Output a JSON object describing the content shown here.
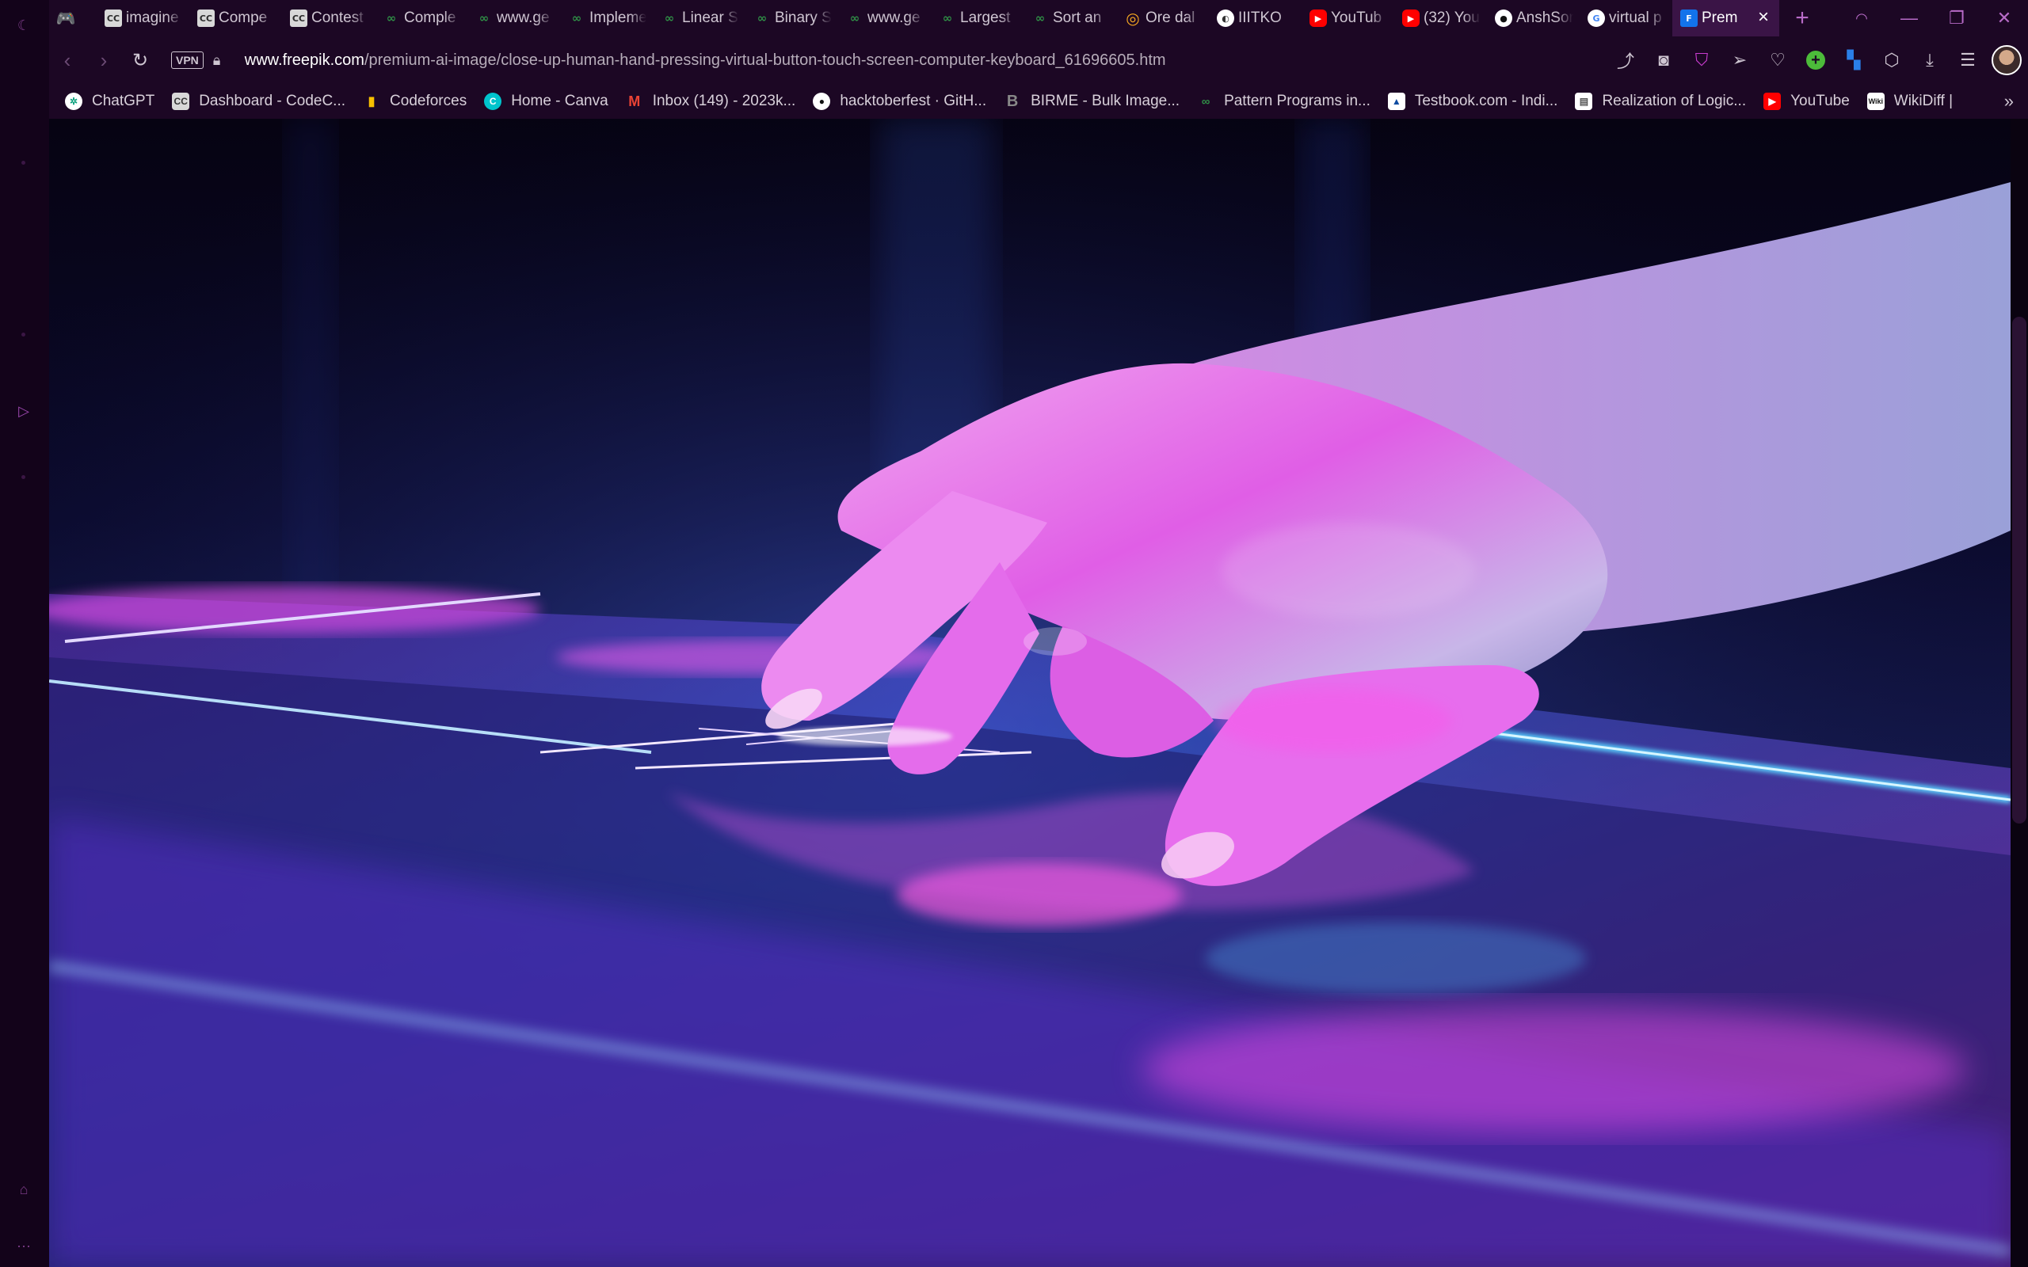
{
  "tabs": [
    {
      "title": "",
      "favicon": "game-icon",
      "fav_class": "fav-game",
      "fav_glyph": "🎮"
    },
    {
      "title": "imagine",
      "favicon": "codechef-icon",
      "fav_class": "fav-cc",
      "fav_glyph": "CC"
    },
    {
      "title": "Compe",
      "favicon": "codechef-icon",
      "fav_class": "fav-cc",
      "fav_glyph": "CC"
    },
    {
      "title": "Contest",
      "favicon": "codechef-icon",
      "fav_class": "fav-cc",
      "fav_glyph": "CC"
    },
    {
      "title": "Comple",
      "favicon": "geeksforgeeks-icon",
      "fav_class": "fav-gfg",
      "fav_glyph": "∞"
    },
    {
      "title": "www.ge",
      "favicon": "geeksforgeeks-icon",
      "fav_class": "fav-gfg",
      "fav_glyph": "∞"
    },
    {
      "title": "Impleme",
      "favicon": "geeksforgeeks-icon",
      "fav_class": "fav-gfg",
      "fav_glyph": "∞"
    },
    {
      "title": "Linear S",
      "favicon": "geeksforgeeks-icon",
      "fav_class": "fav-gfg",
      "fav_glyph": "∞"
    },
    {
      "title": "Binary S",
      "favicon": "geeksforgeeks-icon",
      "fav_class": "fav-gfg",
      "fav_glyph": "∞"
    },
    {
      "title": "www.ge",
      "favicon": "geeksforgeeks-icon",
      "fav_class": "fav-gfg",
      "fav_glyph": "∞"
    },
    {
      "title": "Largest",
      "favicon": "geeksforgeeks-icon",
      "fav_class": "fav-gfg",
      "fav_glyph": "∞"
    },
    {
      "title": "Sort an",
      "favicon": "geeksforgeeks-icon",
      "fav_class": "fav-gfg",
      "fav_glyph": "∞"
    },
    {
      "title": "Ore dal",
      "favicon": "ore-icon",
      "fav_class": "fav-ore",
      "fav_glyph": "◎"
    },
    {
      "title": "IIITKO",
      "favicon": "iiitk-icon",
      "fav_class": "fav-iiit",
      "fav_glyph": "◐"
    },
    {
      "title": "YouTub",
      "favicon": "youtube-icon",
      "fav_class": "fav-yt",
      "fav_glyph": "▶"
    },
    {
      "title": "(32) You",
      "favicon": "youtube-icon",
      "fav_class": "fav-yt",
      "fav_glyph": "▶"
    },
    {
      "title": "AnshSon",
      "favicon": "github-icon",
      "fav_class": "fav-gh",
      "fav_glyph": "●"
    },
    {
      "title": "virtual p",
      "favicon": "google-icon",
      "fav_class": "fav-g",
      "fav_glyph": "G"
    },
    {
      "title": "Prem",
      "favicon": "freepik-icon",
      "fav_class": "fav-f",
      "fav_glyph": "F",
      "active": true
    }
  ],
  "address": {
    "url_host": "www.freepik.com",
    "url_path": "/premium-ai-image/close-up-human-hand-pressing-virtual-button-touch-screen-computer-keyboard_61696605.htm",
    "vpn_label": "VPN"
  },
  "bookmarks": [
    {
      "label": "ChatGPT",
      "icon": "chatgpt-icon",
      "cls": "bico-gpt",
      "glyph": "✲"
    },
    {
      "label": "Dashboard - CodeC...",
      "icon": "codechef-icon",
      "cls": "bico-cc",
      "glyph": "CC"
    },
    {
      "label": "Codeforces",
      "icon": "codeforces-icon",
      "cls": "bico-cf",
      "glyph": "▮"
    },
    {
      "label": "Home - Canva",
      "icon": "canva-icon",
      "cls": "bico-canva",
      "glyph": "C"
    },
    {
      "label": "Inbox (149) - 2023k...",
      "icon": "gmail-icon",
      "cls": "bico-gmail",
      "glyph": "M"
    },
    {
      "label": "hacktoberfest · GitH...",
      "icon": "github-icon",
      "cls": "bico-gh",
      "glyph": "●"
    },
    {
      "label": "BIRME - Bulk Image...",
      "icon": "birme-icon",
      "cls": "bico-birme",
      "glyph": "B"
    },
    {
      "label": "Pattern Programs in...",
      "icon": "geeksforgeeks-icon",
      "cls": "bico-gfg",
      "glyph": "∞"
    },
    {
      "label": "Testbook.com - Indi...",
      "icon": "testbook-icon",
      "cls": "bico-tb",
      "glyph": "▲"
    },
    {
      "label": "Realization of Logic...",
      "icon": "document-icon",
      "cls": "bico-doc",
      "glyph": "▤"
    },
    {
      "label": "YouTube",
      "icon": "youtube-icon",
      "cls": "bico-yt",
      "glyph": "▶"
    },
    {
      "label": "WikiDiff |",
      "icon": "wikidiff-icon",
      "cls": "bico-wiki",
      "glyph": "Wiki"
    }
  ],
  "colors": {
    "chrome_bg": "#1c0724",
    "active_tab": "#3a1446",
    "accent": "#b86bc8"
  }
}
